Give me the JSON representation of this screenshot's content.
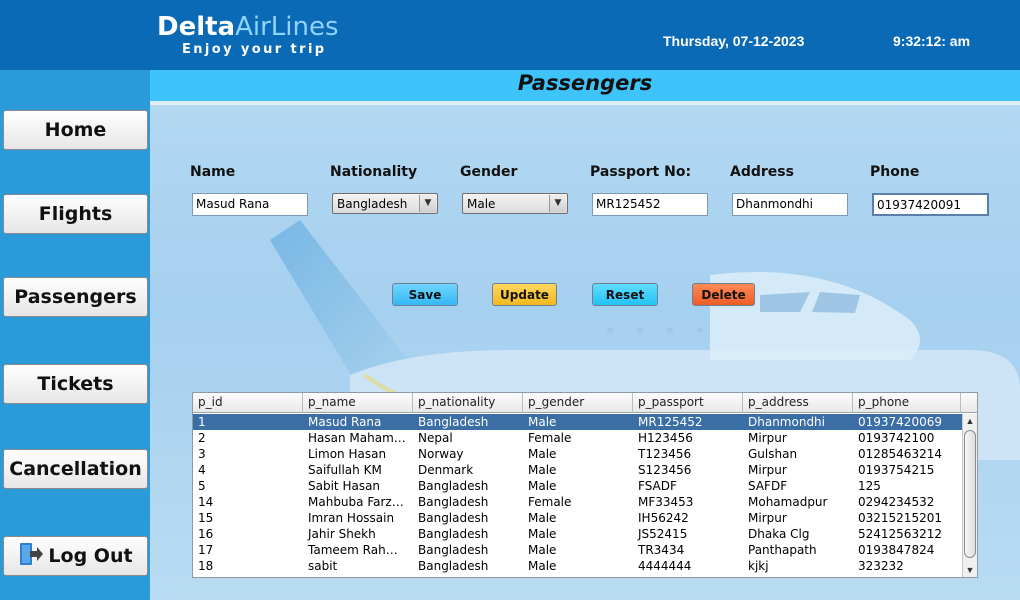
{
  "header": {
    "logo_delta": "Delta",
    "logo_airlines": "AirLines",
    "tagline": "Enjoy your trip",
    "date": "Thursday, 07-12-2023",
    "time": "9:32:12: am"
  },
  "sidebar": {
    "items": [
      {
        "label": "Home"
      },
      {
        "label": "Flights"
      },
      {
        "label": "Passengers"
      },
      {
        "label": "Tickets"
      },
      {
        "label": "Cancellation"
      },
      {
        "label": "Log Out",
        "icon": "logout-icon"
      }
    ]
  },
  "page": {
    "title": "Passengers"
  },
  "form": {
    "name": {
      "label": "Name",
      "value": "Masud Rana"
    },
    "nationality": {
      "label": "Nationality",
      "value": "Bangladesh"
    },
    "gender": {
      "label": "Gender",
      "value": "Male"
    },
    "passport": {
      "label": "Passport No:",
      "value": "MR125452"
    },
    "address": {
      "label": "Address",
      "value": "Dhanmondhi"
    },
    "phone": {
      "label": "Phone",
      "value": "01937420091"
    }
  },
  "actions": {
    "save": "Save",
    "update": "Update",
    "reset": "Reset",
    "delete": "Delete"
  },
  "colors": {
    "header": "#0a6ab5",
    "sidebar": "#2a9ad8",
    "title_bar": "#3ec3fb",
    "save": "#3ec3fb",
    "update": "#f7c436",
    "reset": "#30cdfb",
    "delete": "#f26d3a",
    "selected_row": "#3a6ea5"
  },
  "table": {
    "columns": [
      "p_id",
      "p_name",
      "p_nationality",
      "p_gender",
      "p_passport",
      "p_address",
      "p_phone"
    ],
    "rows": [
      [
        "1",
        "Masud Rana",
        "Bangladesh",
        "Male",
        "MR125452",
        "Dhanmondhi",
        "01937420069"
      ],
      [
        "2",
        "Hasan Mahamud",
        "Nepal",
        "Female",
        "H123456",
        "Mirpur",
        "0193742100"
      ],
      [
        "3",
        "Limon Hasan",
        "Norway",
        "Male",
        "T123456",
        "Gulshan",
        "01285463214"
      ],
      [
        "4",
        "Saifullah KM",
        "Denmark",
        "Male",
        "S123456",
        "Mirpur",
        "0193754215"
      ],
      [
        "5",
        "Sabit Hasan",
        "Bangladesh",
        "Male",
        "FSADF",
        "SAFDF",
        "125"
      ],
      [
        "14",
        "Mahbuba Farzana",
        "Bangladesh",
        "Female",
        "MF33453",
        "Mohamadpur",
        "0294234532"
      ],
      [
        "15",
        "Imran Hossain",
        "Bangladesh",
        "Male",
        "IH56242",
        "Mirpur",
        "03215215201"
      ],
      [
        "16",
        "Jahir Shekh",
        "Bangladesh",
        "Male",
        "JS52415",
        "Dhaka Clg",
        "52412563212"
      ],
      [
        "17",
        "Tameem Rahm...",
        "Bangladesh",
        "Male",
        "TR3434",
        "Panthapath",
        "0193847824"
      ],
      [
        "18",
        "sabit",
        "Bangladesh",
        "Male",
        "4444444",
        "kjkj",
        "323232"
      ]
    ],
    "selected_index": 0
  }
}
